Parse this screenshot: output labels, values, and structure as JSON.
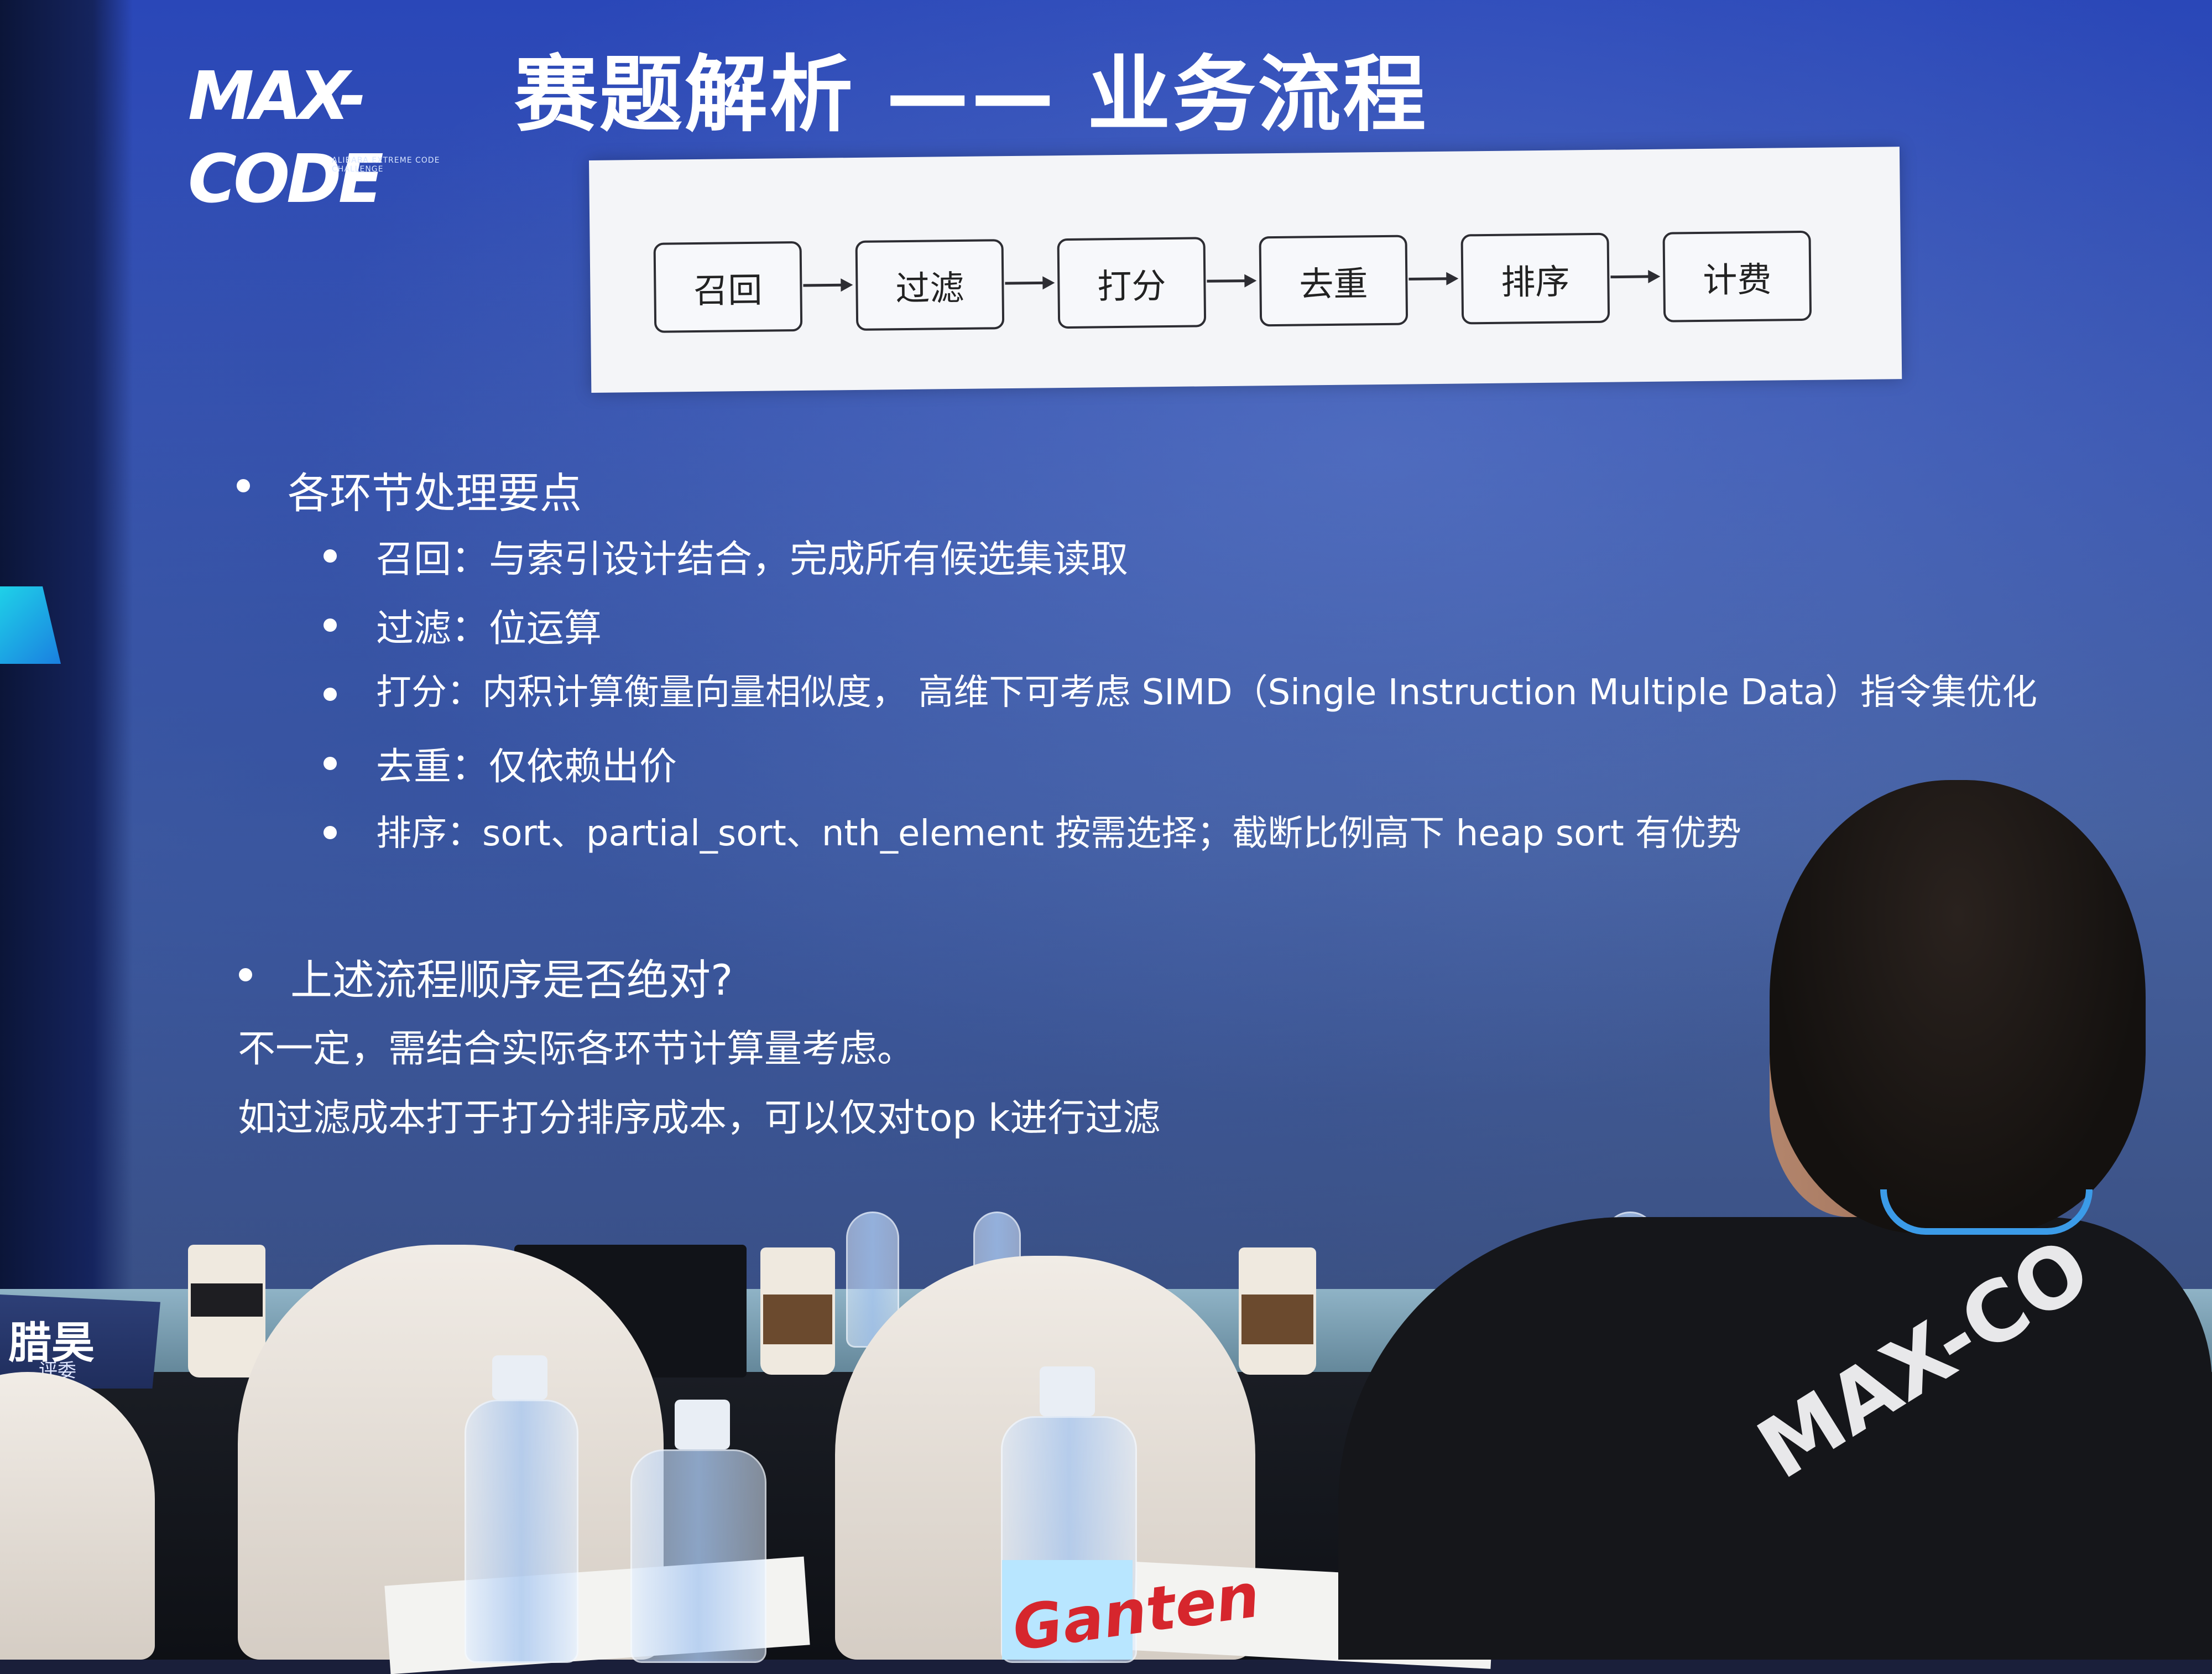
{
  "slide": {
    "logo_text": "MAX-CODE",
    "logo_sub": "ALIBABA EXTREME CODE CHALLENGE",
    "title": "赛题解析 —— 业务流程",
    "flow_steps": [
      "召回",
      "过滤",
      "打分",
      "去重",
      "排序",
      "计费"
    ],
    "section1": {
      "heading": "各环节处理要点",
      "items": [
        "召回：与索引设计结合，完成所有候选集读取",
        "过滤：位运算",
        "打分：内积计算衡量向量相似度，  高维下可考虑 SIMD（Single Instruction Multiple Data）指令集优化",
        "去重：仅依赖出价",
        "排序：sort、partial_sort、nth_element 按需选择；截断比例高下 heap sort 有优势"
      ]
    },
    "section2": {
      "heading": "上述流程顺序是否绝对?",
      "lines": [
        "不一定，需结合实际各环节计算量考虑。",
        "如过滤成本打于打分排序成本，可以仅对top k进行过滤"
      ]
    }
  },
  "room": {
    "nameplate_name": "腊昊",
    "nameplate_role": "评委",
    "shirt_print": "MAX-CO",
    "bottle_brand": "Ganten"
  },
  "colors": {
    "slide_bg": "#3a56b0",
    "panel_bg": "#f4f5f8",
    "logo_accent": "#2aa9ff",
    "text": "#ffffff"
  }
}
